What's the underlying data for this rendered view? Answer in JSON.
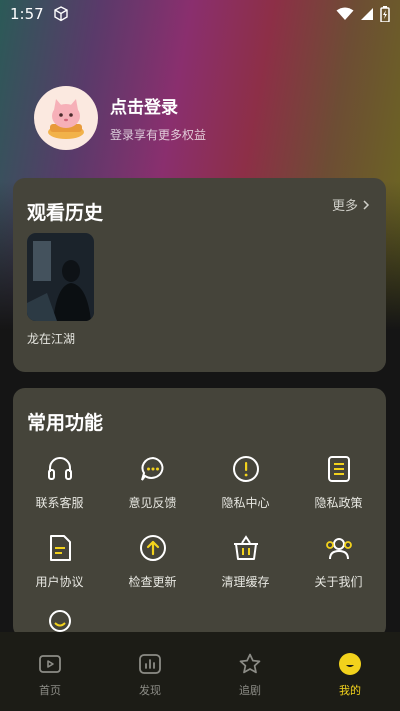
{
  "status": {
    "time": "1:57"
  },
  "profile": {
    "title": "点击登录",
    "subtitle": "登录享有更多权益"
  },
  "history": {
    "title": "观看历史",
    "more": "更多",
    "items": [
      {
        "title": "龙在江湖"
      }
    ]
  },
  "functions": {
    "title": "常用功能",
    "items": [
      {
        "label": "联系客服",
        "icon": "headset-icon"
      },
      {
        "label": "意见反馈",
        "icon": "chat-bubble-icon"
      },
      {
        "label": "隐私中心",
        "icon": "exclamation-circle-icon"
      },
      {
        "label": "隐私政策",
        "icon": "document-icon"
      },
      {
        "label": "用户协议",
        "icon": "file-icon"
      },
      {
        "label": "检查更新",
        "icon": "upload-circle-icon"
      },
      {
        "label": "清理缓存",
        "icon": "basket-icon"
      },
      {
        "label": "关于我们",
        "icon": "people-icon"
      }
    ]
  },
  "tabbar": {
    "items": [
      {
        "label": "首页",
        "icon": "play-icon"
      },
      {
        "label": "发现",
        "icon": "chart-icon"
      },
      {
        "label": "追剧",
        "icon": "star-icon"
      },
      {
        "label": "我的",
        "icon": "smile-icon"
      }
    ],
    "active": "我的"
  },
  "colors": {
    "accent": "#f2d21c",
    "card": "#45443a",
    "background": "#151515"
  }
}
